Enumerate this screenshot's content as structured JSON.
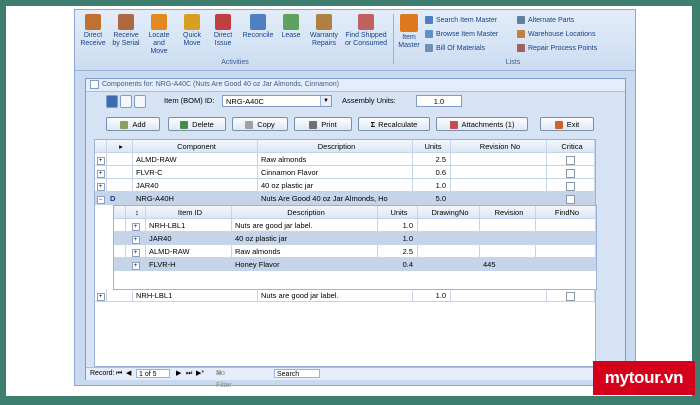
{
  "ribbon": {
    "activities_label": "Activities",
    "lists_label": "Lists",
    "buttons": [
      {
        "label": "Direct Receive",
        "icon": "receive-icon",
        "color": "#c07030"
      },
      {
        "label": "Receive by Serial",
        "icon": "serial-icon",
        "color": "#b06840"
      },
      {
        "label": "Locate and Move",
        "icon": "move-icon",
        "color": "#e08a20"
      },
      {
        "label": "Quick Move",
        "icon": "quick-move-icon",
        "color": "#d8a020"
      },
      {
        "label": "Direct Issue",
        "icon": "issue-icon",
        "color": "#c04040"
      },
      {
        "label": "Reconcile",
        "icon": "reconcile-icon",
        "color": "#5080c0"
      },
      {
        "label": "Lease",
        "icon": "lease-icon",
        "color": "#60a060"
      },
      {
        "label": "Warranty Repairs",
        "icon": "warranty-icon",
        "color": "#b08040"
      },
      {
        "label": "Find Shipped or Consumed",
        "icon": "find-shipped-icon",
        "color": "#c06060"
      }
    ],
    "item_master": {
      "label": "Item Master",
      "icon": "item-master-icon",
      "color": "#e07820"
    },
    "list_links": [
      {
        "label": "Search Item Master",
        "icon": "search-icon"
      },
      {
        "label": "Browse Item Master",
        "icon": "browse-icon"
      },
      {
        "label": "Bill Of Materials",
        "icon": "bom-icon"
      },
      {
        "label": "Alternate Parts",
        "icon": "alternate-parts-icon"
      },
      {
        "label": "Warehouse Locations",
        "icon": "warehouse-icon"
      },
      {
        "label": "Repair Process Points",
        "icon": "repair-icon"
      }
    ]
  },
  "form": {
    "title": "Components for: NRG-A40C (Nuts Are Good 40 oz Jar Almonds, Cinnamon)",
    "item_id_label": "Item (BOM) ID:",
    "item_id_value": "NRG-A40C",
    "assembly_units_label": "Assembly Units:",
    "assembly_units_value": "1.0",
    "buttons": {
      "add": "Add",
      "delete": "Delete",
      "copy": "Copy",
      "print": "Print",
      "recalculate": "Recalculate",
      "attachments": "Attachments (1)",
      "exit": "Exit"
    }
  },
  "grid": {
    "headers": {
      "component": "Component",
      "description": "Description",
      "units": "Units",
      "revision": "Revision No",
      "critical": "Critica"
    },
    "rows": [
      {
        "component": "ALMD-RAW",
        "description": "Raw almonds",
        "units": "2.5"
      },
      {
        "component": "FLVR-C",
        "description": "Cinnamon Flavor",
        "units": "0.6"
      },
      {
        "component": "JAR40",
        "description": "40 oz plastic jar",
        "units": "1.0"
      },
      {
        "component": "NRG-A40H",
        "description": "Nuts Are Good 40 oz Jar Almonds, Ho",
        "units": "5.0"
      },
      {
        "component": "NRH-LBL1",
        "description": "Nuts are good jar label.",
        "units": "1.0"
      }
    ],
    "sub_headers": {
      "item_id": "Item ID",
      "description": "Description",
      "units": "Units",
      "drawing": "DrawingNo",
      "revision": "Revision",
      "find": "FindNo"
    },
    "sub_rows": [
      {
        "item_id": "NRH-LBL1",
        "description": "Nuts are good jar label.",
        "units": "1.0",
        "revision": ""
      },
      {
        "item_id": "JAR40",
        "description": "40 oz plastic jar",
        "units": "1.0",
        "revision": ""
      },
      {
        "item_id": "ALMD-RAW",
        "description": "Raw almonds",
        "units": "2.5",
        "revision": ""
      },
      {
        "item_id": "FLVR-H",
        "description": "Honey Flavor",
        "units": "0.4",
        "revision": "445"
      }
    ]
  },
  "status": {
    "record_label": "Record:",
    "record_value": "1 of 5",
    "filter_label": "No Filter",
    "search_label": "Search"
  },
  "watermark": "mytour.vn"
}
